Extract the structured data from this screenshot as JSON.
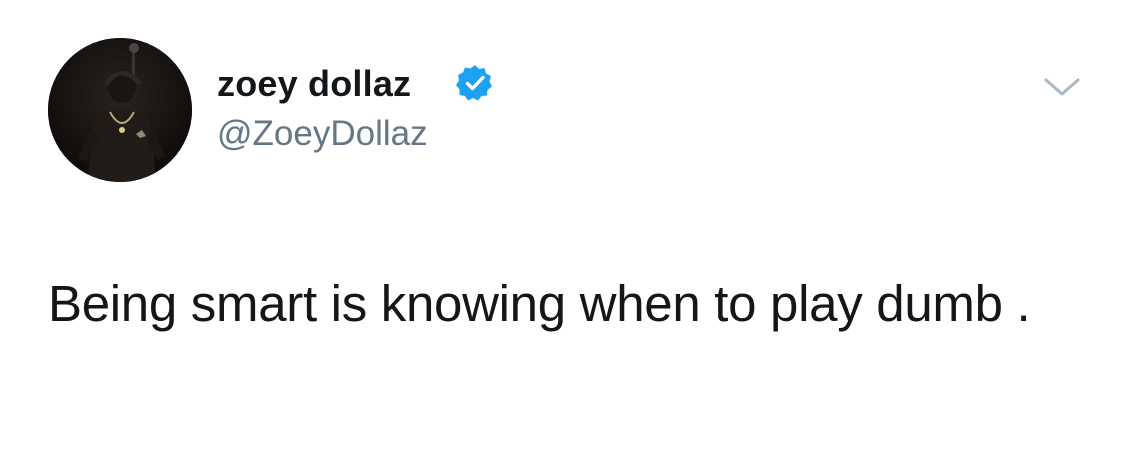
{
  "tweet": {
    "display_name": "zoey dollaz",
    "handle": "@ZoeyDollaz",
    "verified": true,
    "text": "Being smart is knowing when to play dumb ."
  },
  "icons": {
    "verified": "verified-badge-icon",
    "menu": "chevron-down-icon"
  },
  "colors": {
    "name": "#14171a",
    "handle": "#657786",
    "verified": "#1da1f2",
    "caret": "#aab8c2"
  }
}
